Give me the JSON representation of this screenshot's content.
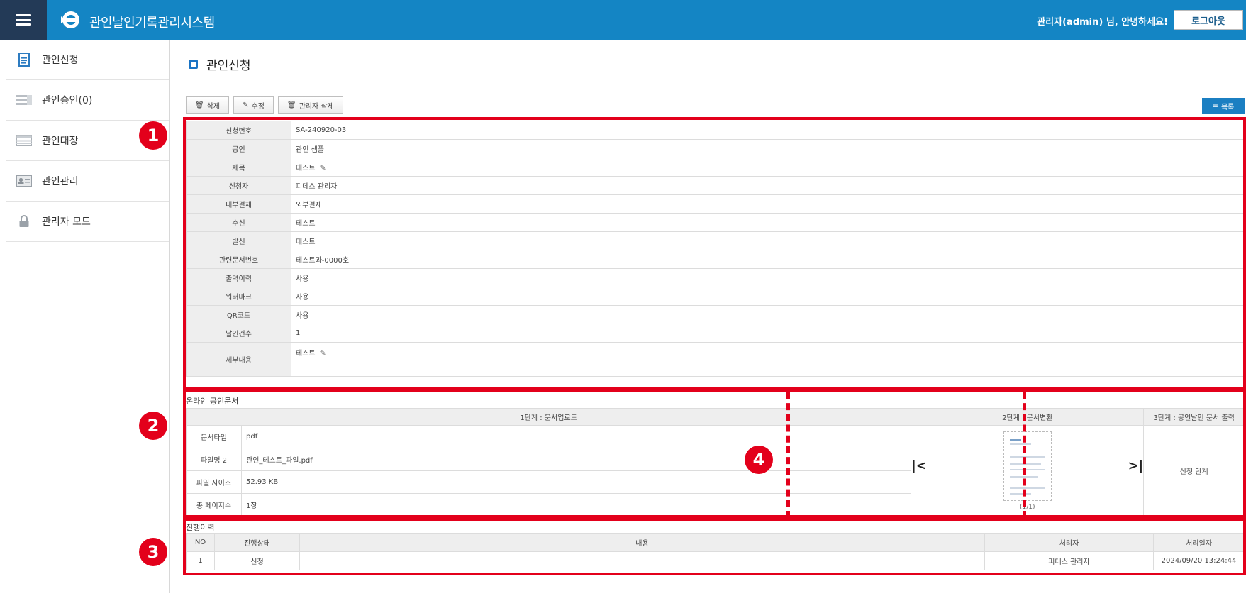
{
  "header": {
    "app_title": "관인날인기록관리시스템",
    "greeting": "관리자(admin) 님, 안녕하세요!",
    "logout_label": "로그아웃"
  },
  "sidebar": {
    "items": [
      {
        "label": "관인신청",
        "icon": "document-icon"
      },
      {
        "label": "관인승인(0)",
        "icon": "list-icon"
      },
      {
        "label": "관인대장",
        "icon": "ledger-icon"
      },
      {
        "label": "관인관리",
        "icon": "id-card-icon"
      },
      {
        "label": "관리자 모드",
        "icon": "lock-icon"
      }
    ]
  },
  "page": {
    "title": "관인신청"
  },
  "toolbar": {
    "delete_label": "삭제",
    "edit_label": "수정",
    "admin_delete_label": "관리자 삭제",
    "list_label": "목록"
  },
  "info": {
    "rows": [
      {
        "key": "신청번호",
        "value": "SA-240920-03"
      },
      {
        "key": "공인",
        "value": "관인 샘플"
      },
      {
        "key": "제목",
        "value": "테스트"
      },
      {
        "key": "신청자",
        "value": "피데스 관리자"
      },
      {
        "key": "내부결재",
        "value": "외부결재"
      },
      {
        "key": "수신",
        "value": "테스트"
      },
      {
        "key": "발신",
        "value": "테스트"
      },
      {
        "key": "관련문서번호",
        "value": "테스트과-0000호"
      },
      {
        "key": "출력이력",
        "value": "사용"
      },
      {
        "key": "워터마크",
        "value": "사용"
      },
      {
        "key": "QR코드",
        "value": "사용"
      },
      {
        "key": "날인건수",
        "value": "1"
      },
      {
        "key": "세부내용",
        "value": "테스트"
      }
    ]
  },
  "online_doc": {
    "section_title": "온라인 공인문서",
    "step1_label": "1단계 : 문서업로드",
    "step2_label": "2단계 : 문서변환",
    "step3_label": "3단계 : 공인날인 문서 출력",
    "rows": [
      {
        "key": "문서타입",
        "value": "pdf"
      },
      {
        "key": "파일명 2",
        "value": "관인_테스트_파일.pdf"
      },
      {
        "key": "파일 사이즈",
        "value": "52.93 KB"
      },
      {
        "key": "총 페이지수",
        "value": "1장"
      }
    ],
    "page_indicator": "(1/1)",
    "step3_status": "신청 단계"
  },
  "history": {
    "section_title": "진행이력",
    "headers": [
      "NO",
      "진행상태",
      "내용",
      "처리자",
      "처리일자"
    ],
    "rows": [
      {
        "no": "1",
        "status": "신청",
        "content": "",
        "handler": "피데스 관리자",
        "date": "2024/09/20 13:24:44"
      }
    ]
  },
  "annotations": [
    "1",
    "2",
    "3",
    "4"
  ],
  "colors": {
    "header_bg": "#1485c4",
    "menu_bg": "#233a57",
    "accent": "#1b7fc2",
    "highlight": "#e3001b"
  }
}
